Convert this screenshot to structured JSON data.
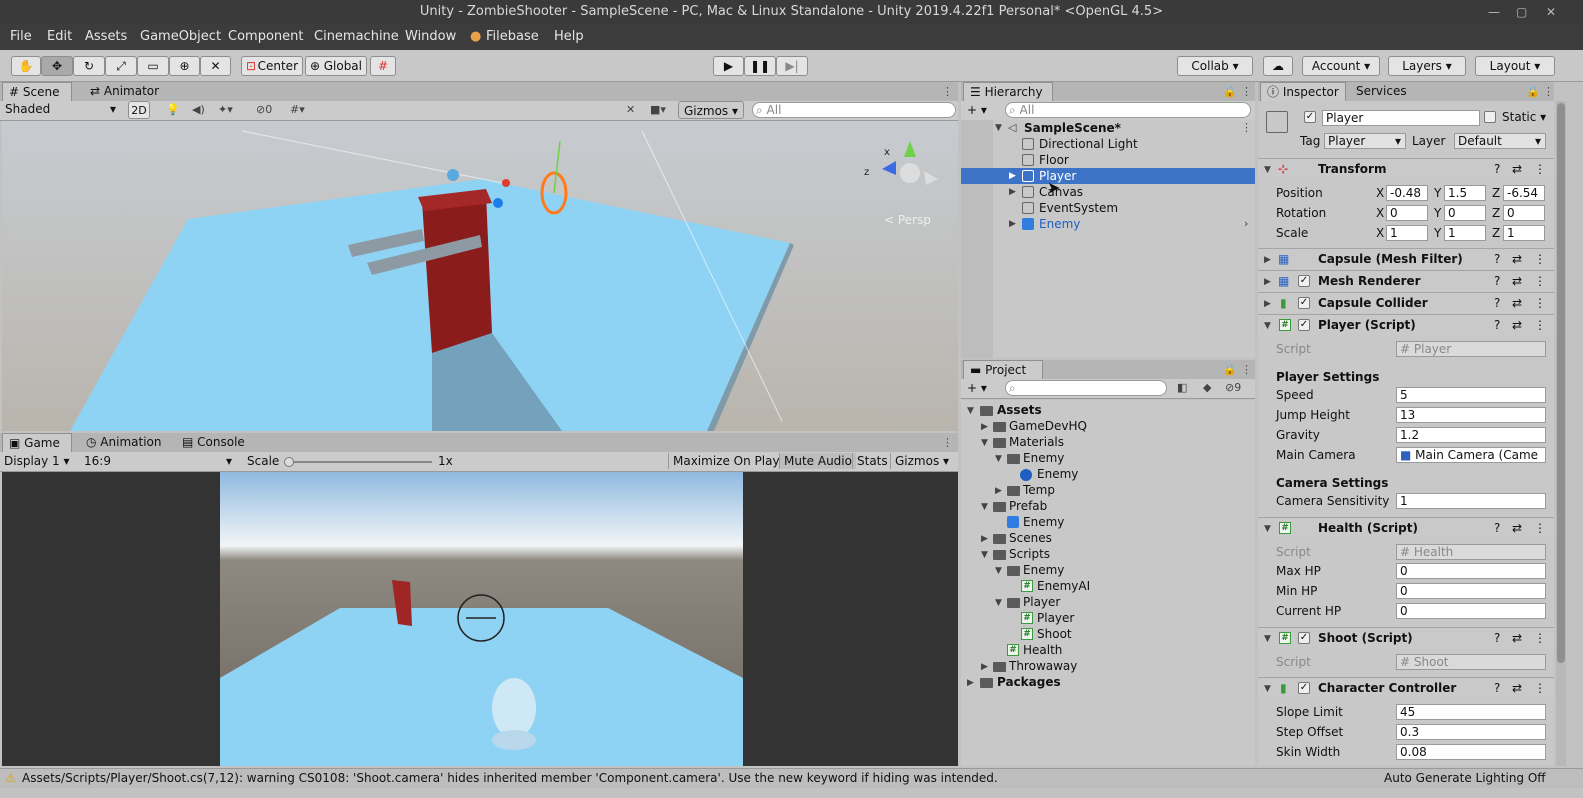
{
  "window": {
    "title": "Unity - ZombieShooter - SampleScene - PC, Mac & Linux Standalone - Unity 2019.4.22f1 Personal* <OpenGL 4.5>"
  },
  "menu": [
    "File",
    "Edit",
    "Assets",
    "GameObject",
    "Component",
    "Cinemachine",
    "Window",
    "Filebase",
    "Help"
  ],
  "toolbar": {
    "center": "Center",
    "global": "Global",
    "collab": "Collab",
    "account": "Account",
    "layers": "Layers",
    "layout": "Layout"
  },
  "scene": {
    "tab": "Scene",
    "tab2": "Animator",
    "shading": "Shaded",
    "twod": "2D",
    "hidden_count": "0",
    "gizmos": "Gizmos",
    "search_placeholder": "All",
    "persp": "Persp"
  },
  "game": {
    "tabs": [
      "Game",
      "Animation",
      "Console"
    ],
    "display": "Display 1",
    "aspect": "16:9",
    "scale_label": "Scale",
    "scale_value": "1x",
    "maximize": "Maximize On Play",
    "mute": "Mute Audio",
    "stats": "Stats",
    "gizmos": "Gizmos"
  },
  "hierarchy": {
    "tab": "Hierarchy",
    "search_placeholder": "All",
    "scene": "SampleScene*",
    "items": [
      "Directional Light",
      "Floor",
      "Player",
      "Canvas",
      "EventSystem",
      "Enemy"
    ]
  },
  "project": {
    "tab": "Project",
    "hidden_count": "9",
    "tree": [
      "Assets",
      "GameDevHQ",
      "Materials",
      "Enemy",
      "Enemy",
      "Temp",
      "Prefab",
      "Enemy",
      "Scenes",
      "Scripts",
      "Enemy",
      "EnemyAI",
      "Player",
      "Player",
      "Shoot",
      "Health",
      "Throwaway",
      "Packages"
    ]
  },
  "inspector": {
    "tab": "Inspector",
    "tab2": "Services",
    "name": "Player",
    "static": "Static",
    "tag_label": "Tag",
    "tag": "Player",
    "layer_label": "Layer",
    "layer": "Default",
    "transform": {
      "title": "Transform",
      "rows": [
        {
          "label": "Position",
          "x": "-0.48",
          "y": "1.5",
          "z": "-6.54"
        },
        {
          "label": "Rotation",
          "x": "0",
          "y": "0",
          "z": "0"
        },
        {
          "label": "Scale",
          "x": "1",
          "y": "1",
          "z": "1"
        }
      ]
    },
    "components": [
      "Capsule (Mesh Filter)",
      "Mesh Renderer",
      "Capsule Collider",
      "Player (Script)",
      "Health (Script)",
      "Shoot (Script)",
      "Character Controller"
    ],
    "player_script": {
      "script_label": "Script",
      "script": "Player",
      "section": "Player Settings",
      "speed_label": "Speed",
      "speed": "5",
      "jump_label": "Jump Height",
      "jump": "13",
      "gravity_label": "Gravity",
      "gravity": "1.2",
      "camera_label": "Main Camera",
      "camera": "Main Camera (Came",
      "cam_section": "Camera Settings",
      "sens_label": "Camera Sensitivity",
      "sens": "1"
    },
    "health_script": {
      "script_label": "Script",
      "script": "Health",
      "maxhp_label": "Max HP",
      "maxhp": "0",
      "minhp_label": "Min HP",
      "minhp": "0",
      "curhp_label": "Current HP",
      "curhp": "0"
    },
    "shoot_script": {
      "script_label": "Script",
      "script": "Shoot"
    },
    "cc": {
      "slope_label": "Slope Limit",
      "slope": "45",
      "step_label": "Step Offset",
      "step": "0.3",
      "skin_label": "Skin Width",
      "skin": "0.08"
    }
  },
  "status": {
    "warning": "Assets/Scripts/Player/Shoot.cs(7,12): warning CS0108: 'Shoot.camera' hides inherited member 'Component.camera'. Use the new keyword if hiding was intended.",
    "right": "Auto Generate Lighting Off"
  }
}
